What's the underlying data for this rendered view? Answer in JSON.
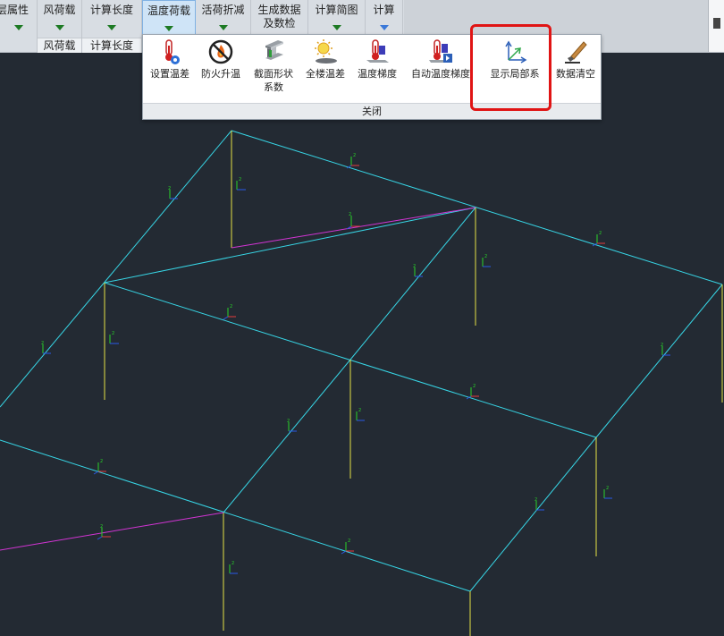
{
  "ribbon": {
    "tabs": [
      {
        "label": "层属性",
        "sub": ""
      },
      {
        "label": "风荷载",
        "sub": "风荷载"
      },
      {
        "label": "计算长度",
        "sub": "计算长度"
      },
      {
        "label": "温度荷载",
        "sub": ""
      },
      {
        "label": "活荷折减",
        "sub": ""
      },
      {
        "label_line1": "生成数据",
        "label_line2": "及数检",
        "sub": ""
      },
      {
        "label": "计算简图",
        "sub": ""
      },
      {
        "label": "计算",
        "sub": ""
      }
    ]
  },
  "dropdown": {
    "items": [
      {
        "label": "设置温差",
        "icon": "thermometer-gear-icon"
      },
      {
        "label": "防火升温",
        "icon": "fire-prohibit-icon"
      },
      {
        "label_line1": "截面形状",
        "label_line2": "系数",
        "icon": "steel-section-icon"
      },
      {
        "label": "全楼温差",
        "icon": "sun-icon"
      },
      {
        "label": "温度梯度",
        "icon": "thermometer-slab-icon"
      },
      {
        "label": "自动温度梯度",
        "icon": "thermometer-auto-icon"
      },
      {
        "label": "显示局部系",
        "icon": "local-axes-icon"
      },
      {
        "label": "数据清空",
        "icon": "eraser-icon"
      }
    ],
    "close_label": "关闭"
  },
  "colors": {
    "background": "#232a33",
    "beam": "#37d6e6",
    "column": "#e6e244",
    "brace": "#d234d4",
    "highlight": "#e01414"
  }
}
